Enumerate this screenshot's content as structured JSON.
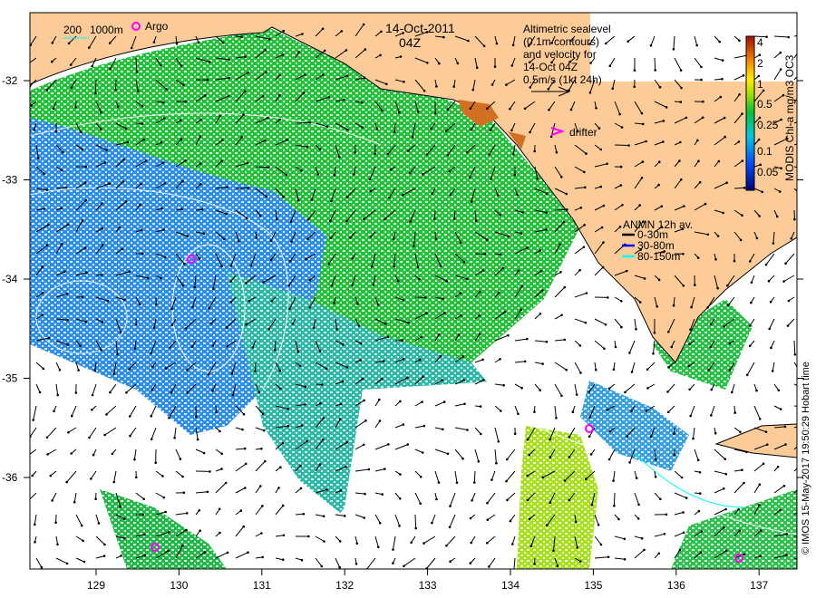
{
  "title": {
    "date": "14-Oct-2011",
    "time": "04Z"
  },
  "depth_legend": {
    "shallow": "200",
    "deep": "1000m",
    "argo_label": "Argo"
  },
  "velocity_legend": {
    "lines": [
      "Altimetric sealevel",
      "(0.1m contours)",
      "and velocity for",
      "14-Oct 04Z",
      "0.5m/s (1kt 24h)"
    ],
    "drifter_label": "drifter"
  },
  "anmn_legend": {
    "title": "ANMN 12h av.",
    "items": [
      {
        "label": "0-30m",
        "color": "#000000"
      },
      {
        "label": "30-80m",
        "color": "#0000ff"
      },
      {
        "label": "80-150m",
        "color": "#00ffff"
      }
    ]
  },
  "colorbar": {
    "label": "MODIS Chl-a mg/m3 OC3",
    "ticks": [
      "4",
      "2",
      "1",
      "0.5",
      "0.25",
      "0.1",
      "0.05"
    ]
  },
  "axes": {
    "x_ticks": [
      "129",
      "130",
      "131",
      "132",
      "133",
      "134",
      "135",
      "136",
      "137"
    ],
    "y_ticks": [
      "-32",
      "-33",
      "-34",
      "-35",
      "-36"
    ]
  },
  "credit": "© IMOS 15-May-2017 19:50:29 Hobart time",
  "colors": {
    "land": "#fdcb98",
    "ocean_green": "#22c43a",
    "ocean_blue": "#2f8fe6",
    "argo": "#ff00ff"
  }
}
